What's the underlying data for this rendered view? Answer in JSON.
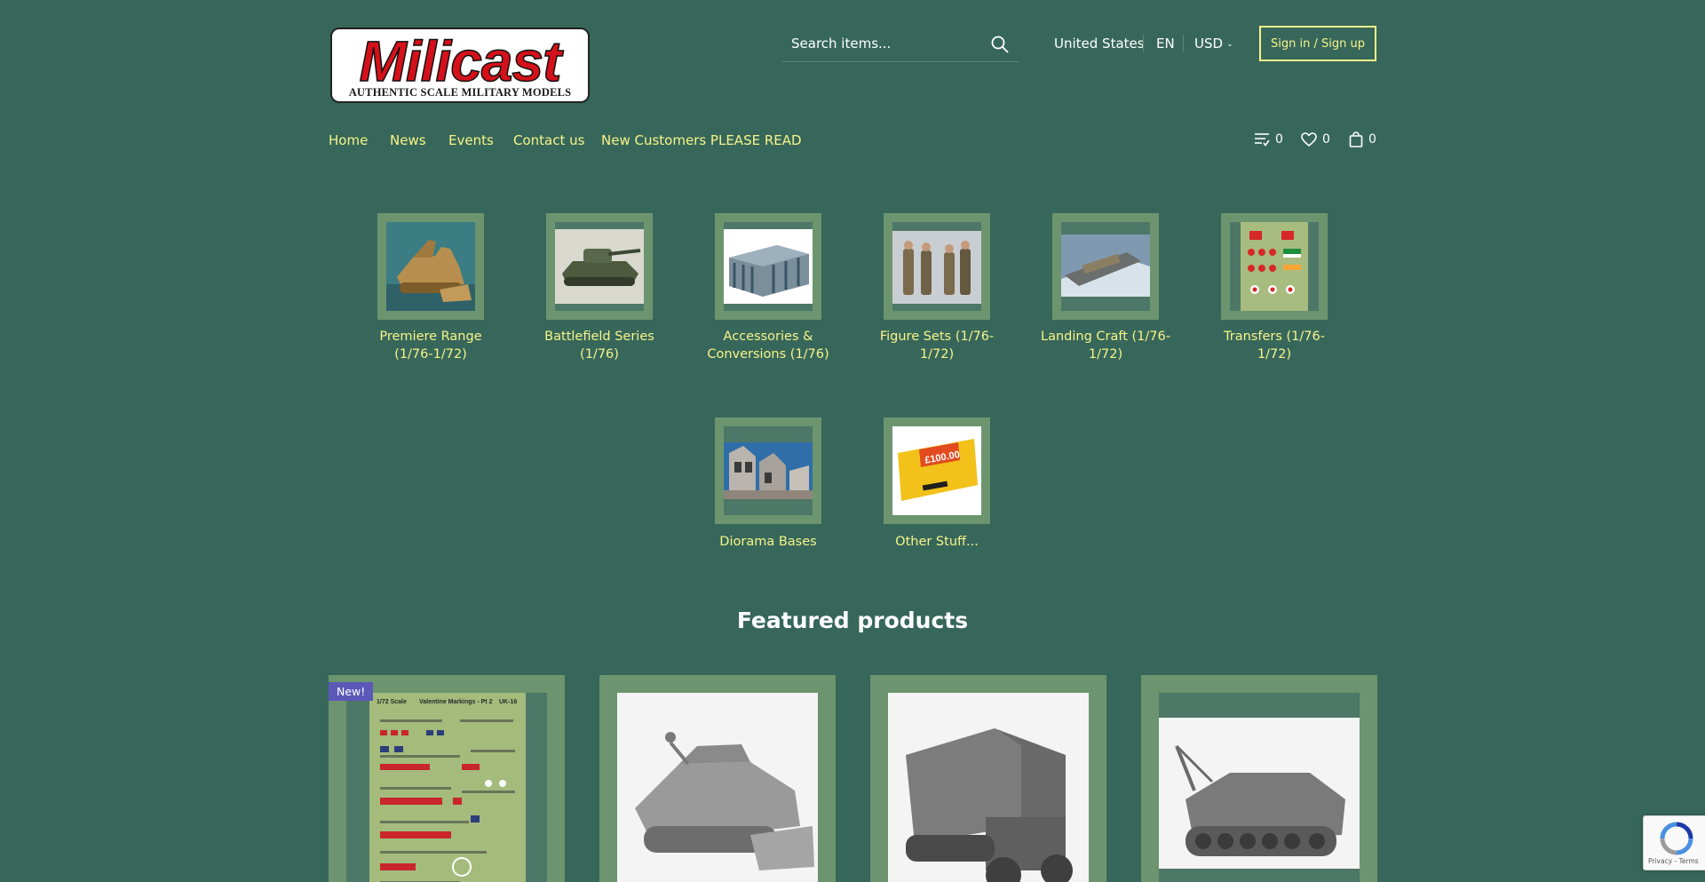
{
  "logo": {
    "word": "Milicast",
    "tagline": "AUTHENTIC SCALE MILITARY MODELS"
  },
  "search": {
    "placeholder": "Search items..."
  },
  "header": {
    "country": "United States",
    "language": "EN",
    "currency": "USD",
    "signin_label": "Sign in / Sign up"
  },
  "nav": {
    "items": [
      "Home",
      "News",
      "Events",
      "Contact us",
      "New Customers PLEASE READ"
    ]
  },
  "counters": {
    "compare": "0",
    "wishlist": "0",
    "cart": "0"
  },
  "categories": [
    {
      "label": "Premiere Range (1/76-1/72)"
    },
    {
      "label": "Battlefield Series (1/76)"
    },
    {
      "label": "Accessories & Conversions (1/76)"
    },
    {
      "label": "Figure Sets (1/76-1/72)"
    },
    {
      "label": "Landing Craft (1/76-1/72)"
    },
    {
      "label": "Transfers (1/76-1/72)"
    },
    {
      "label": "Diorama Bases"
    },
    {
      "label": "Other Stuff..."
    }
  ],
  "voucher_text": "£100.00",
  "featured": {
    "title": "Featured products",
    "badge": "New!",
    "transfer_sheet": {
      "scale": "1/72 Scale",
      "name": "Valentine Markings - Pt 2",
      "code": "UK-16"
    }
  },
  "recaptcha": {
    "footer": "Privacy - Terms"
  },
  "colors": {
    "background": "#37675a",
    "link": "#f7f48a",
    "frame": "#6c956f",
    "badge": "#5b58b8"
  }
}
